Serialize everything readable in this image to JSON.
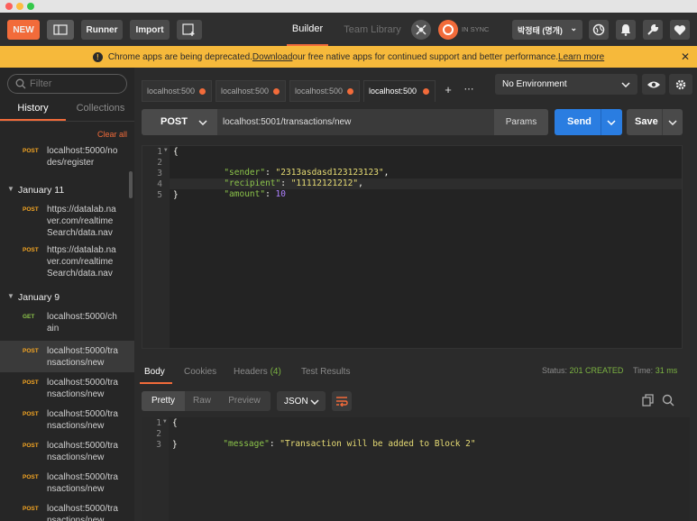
{
  "toolbar": {
    "new_label": "NEW",
    "runner_label": "Runner",
    "import_label": "Import",
    "builder_tab": "Builder",
    "team_library_tab": "Team Library",
    "sync_status": "IN SYNC",
    "user_name": "박정태 (명개)"
  },
  "banner": {
    "text_before": "Chrome apps are being deprecated. ",
    "download_link": "Download",
    "text_after": " our free native apps for continued support and better performance. ",
    "learn_more_link": "Learn more"
  },
  "sidebar": {
    "filter_placeholder": "Filter",
    "tab_history": "History",
    "tab_collections": "Collections",
    "clear_all": "Clear all",
    "top_item": {
      "method": "POST",
      "url": "localhost:5000/nodes/register"
    },
    "groups": [
      {
        "date": "January 11",
        "items": [
          {
            "method": "POST",
            "url": "https://datalab.naver.com/realtimeSearch/data.nav"
          },
          {
            "method": "POST",
            "url": "https://datalab.naver.com/realtimeSearch/data.nav"
          }
        ]
      },
      {
        "date": "January 9",
        "items": [
          {
            "method": "GET",
            "url": "localhost:5000/chain"
          },
          {
            "method": "POST",
            "url": "localhost:5000/transactions/new"
          },
          {
            "method": "POST",
            "url": "localhost:5000/transactions/new"
          },
          {
            "method": "POST",
            "url": "localhost:5000/transactions/new"
          },
          {
            "method": "POST",
            "url": "localhost:5000/transactions/new"
          },
          {
            "method": "POST",
            "url": "localhost:5000/transactions/new"
          },
          {
            "method": "POST",
            "url": "localhost:5000/transactions/new"
          }
        ]
      }
    ]
  },
  "tabs": [
    {
      "label": "localhost:500"
    },
    {
      "label": "localhost:500"
    },
    {
      "label": "localhost:500"
    },
    {
      "label": "localhost:500"
    }
  ],
  "environment": {
    "selected": "No Environment"
  },
  "request": {
    "method": "POST",
    "url": "localhost:5001/transactions/new",
    "params_label": "Params",
    "send_label": "Send",
    "save_label": "Save",
    "body_lines": [
      {
        "num": "1",
        "text": "{"
      },
      {
        "num": "2",
        "key": "\"sender\"",
        "value": "\"2313asdasd123123123\"",
        "tail": ","
      },
      {
        "num": "3",
        "key": "\"recipient\"",
        "value": "\"11112121212\"",
        "tail": ","
      },
      {
        "num": "4",
        "key": "\"amount\"",
        "value": "10",
        "tail": ""
      },
      {
        "num": "5",
        "text": "}"
      }
    ]
  },
  "response": {
    "tab_body": "Body",
    "tab_cookies": "Cookies",
    "tab_headers": "Headers",
    "headers_count": "(4)",
    "tab_test_results": "Test Results",
    "status_label": "Status:",
    "status_value": "201 CREATED",
    "time_label": "Time:",
    "time_value": "31 ms",
    "view_pretty": "Pretty",
    "view_raw": "Raw",
    "view_preview": "Preview",
    "format": "JSON",
    "body_lines": [
      {
        "num": "1",
        "text": "{"
      },
      {
        "num": "2",
        "key": "\"message\"",
        "value": "\"Transaction will be added to Block 2\"",
        "tail": ""
      },
      {
        "num": "3",
        "text": "}"
      }
    ]
  },
  "colors": {
    "accent_orange": "#f26b3a",
    "send_blue": "#2a7de1",
    "post_color": "#f5a623",
    "get_color": "#8bc34a",
    "status_green": "#7cb342",
    "banner_bg": "#f6b93b"
  }
}
